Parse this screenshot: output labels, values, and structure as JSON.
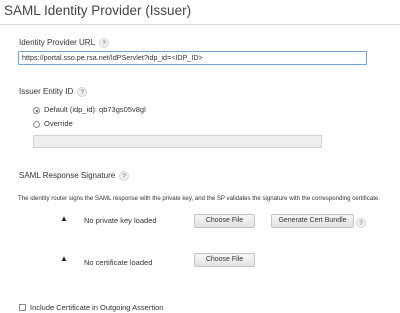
{
  "page": {
    "title": "SAML Identity Provider (Issuer)"
  },
  "idp_url": {
    "label": "Identity Provider URL",
    "help": "?",
    "value": "https://portal.sso.pe.rsa.net/IdPServlet?idp_id=<IDP_ID>"
  },
  "issuer": {
    "label": "Issuer Entity ID",
    "help": "?",
    "default_label": "Default (idp_id): qb73gs05v8gl",
    "override_label": "Override",
    "override_value": "",
    "selected": "default"
  },
  "saml_response": {
    "label": "SAML Response Signature",
    "help": "?",
    "description": "The identity router signs the SAML response with the private key, and the SP validates the signature with the corresponding certificate.",
    "private_key": {
      "icon": "warning-icon",
      "status": "No private key loaded",
      "choose_file_label": "Choose File",
      "generate_label": "Generate Cert Bundle",
      "generate_help": "?"
    },
    "certificate": {
      "icon": "warning-icon",
      "status": "No certificate loaded",
      "choose_file_label": "Choose File"
    }
  },
  "include_cert": {
    "label": "Include Certificate in Outgoing Assertion",
    "checked": false
  }
}
